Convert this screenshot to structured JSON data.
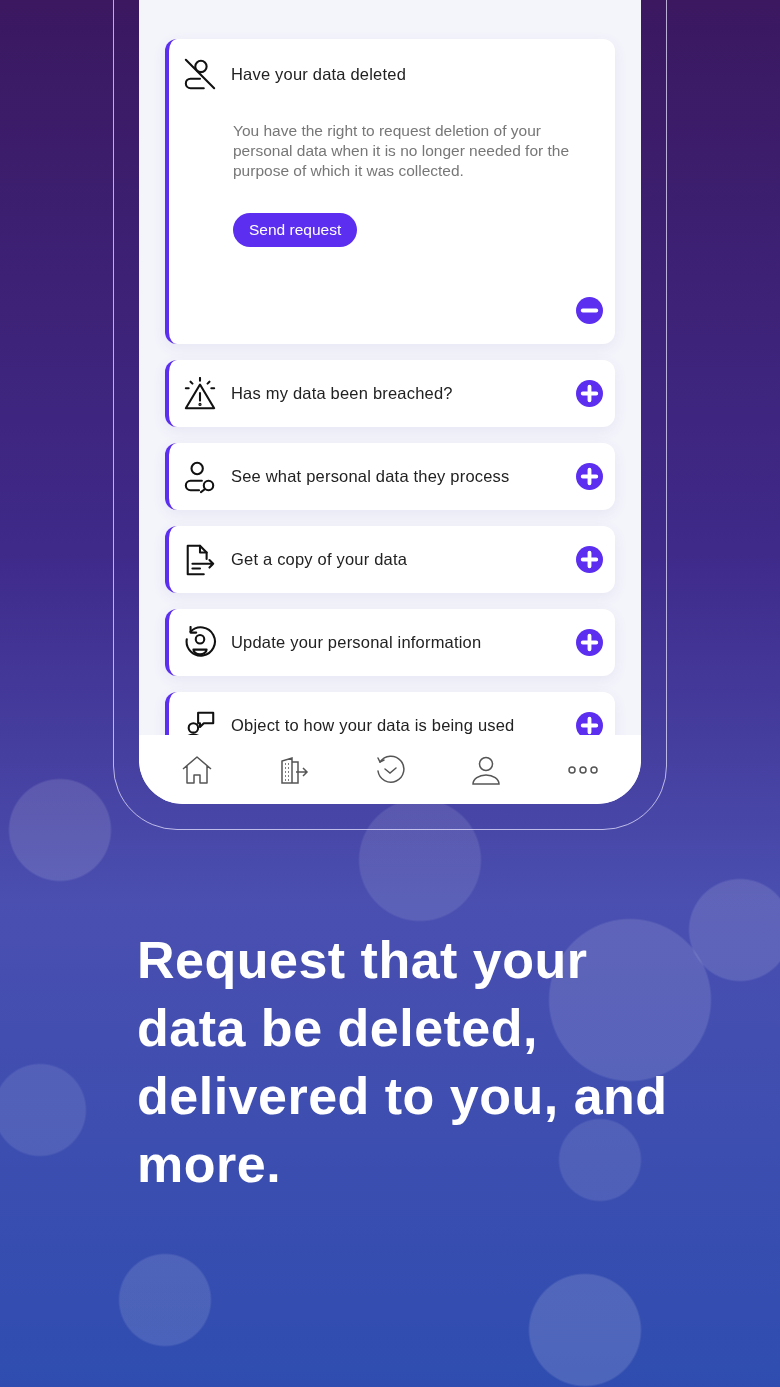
{
  "requests": [
    {
      "title": "Have your data deleted",
      "expanded": true,
      "description": "You have the right to request deletion of your personal data when it is no longer needed for the purpose of which it was collected.",
      "button": "Send request"
    },
    {
      "title": "Has my data been breached?",
      "expanded": false
    },
    {
      "title": "See what personal data they process",
      "expanded": false
    },
    {
      "title": "Get a copy of your data",
      "expanded": false
    },
    {
      "title": "Update your personal information",
      "expanded": false
    },
    {
      "title": "Object to how your data is being used",
      "expanded": false
    }
  ],
  "caption": "Request that your data be deleted, delivered to you, and more."
}
